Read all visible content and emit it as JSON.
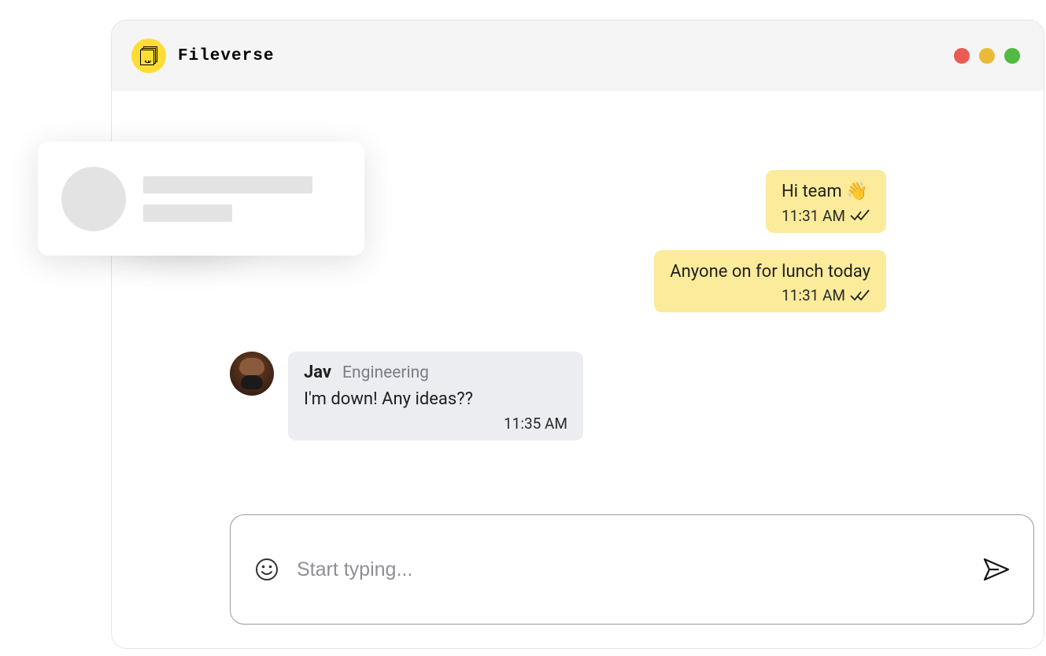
{
  "app": {
    "name": "Fileverse"
  },
  "messages": [
    {
      "side": "sent",
      "text": "Hi team 👋",
      "time": "11:31 AM",
      "read": true
    },
    {
      "side": "sent",
      "text": "Anyone on for lunch today",
      "time": "11:31 AM",
      "read": true
    },
    {
      "side": "recv",
      "sender": "Jav",
      "department": "Engineering",
      "text": "I'm down! Any ideas??",
      "time": "11:35 AM"
    }
  ],
  "composer": {
    "placeholder": "Start typing..."
  }
}
